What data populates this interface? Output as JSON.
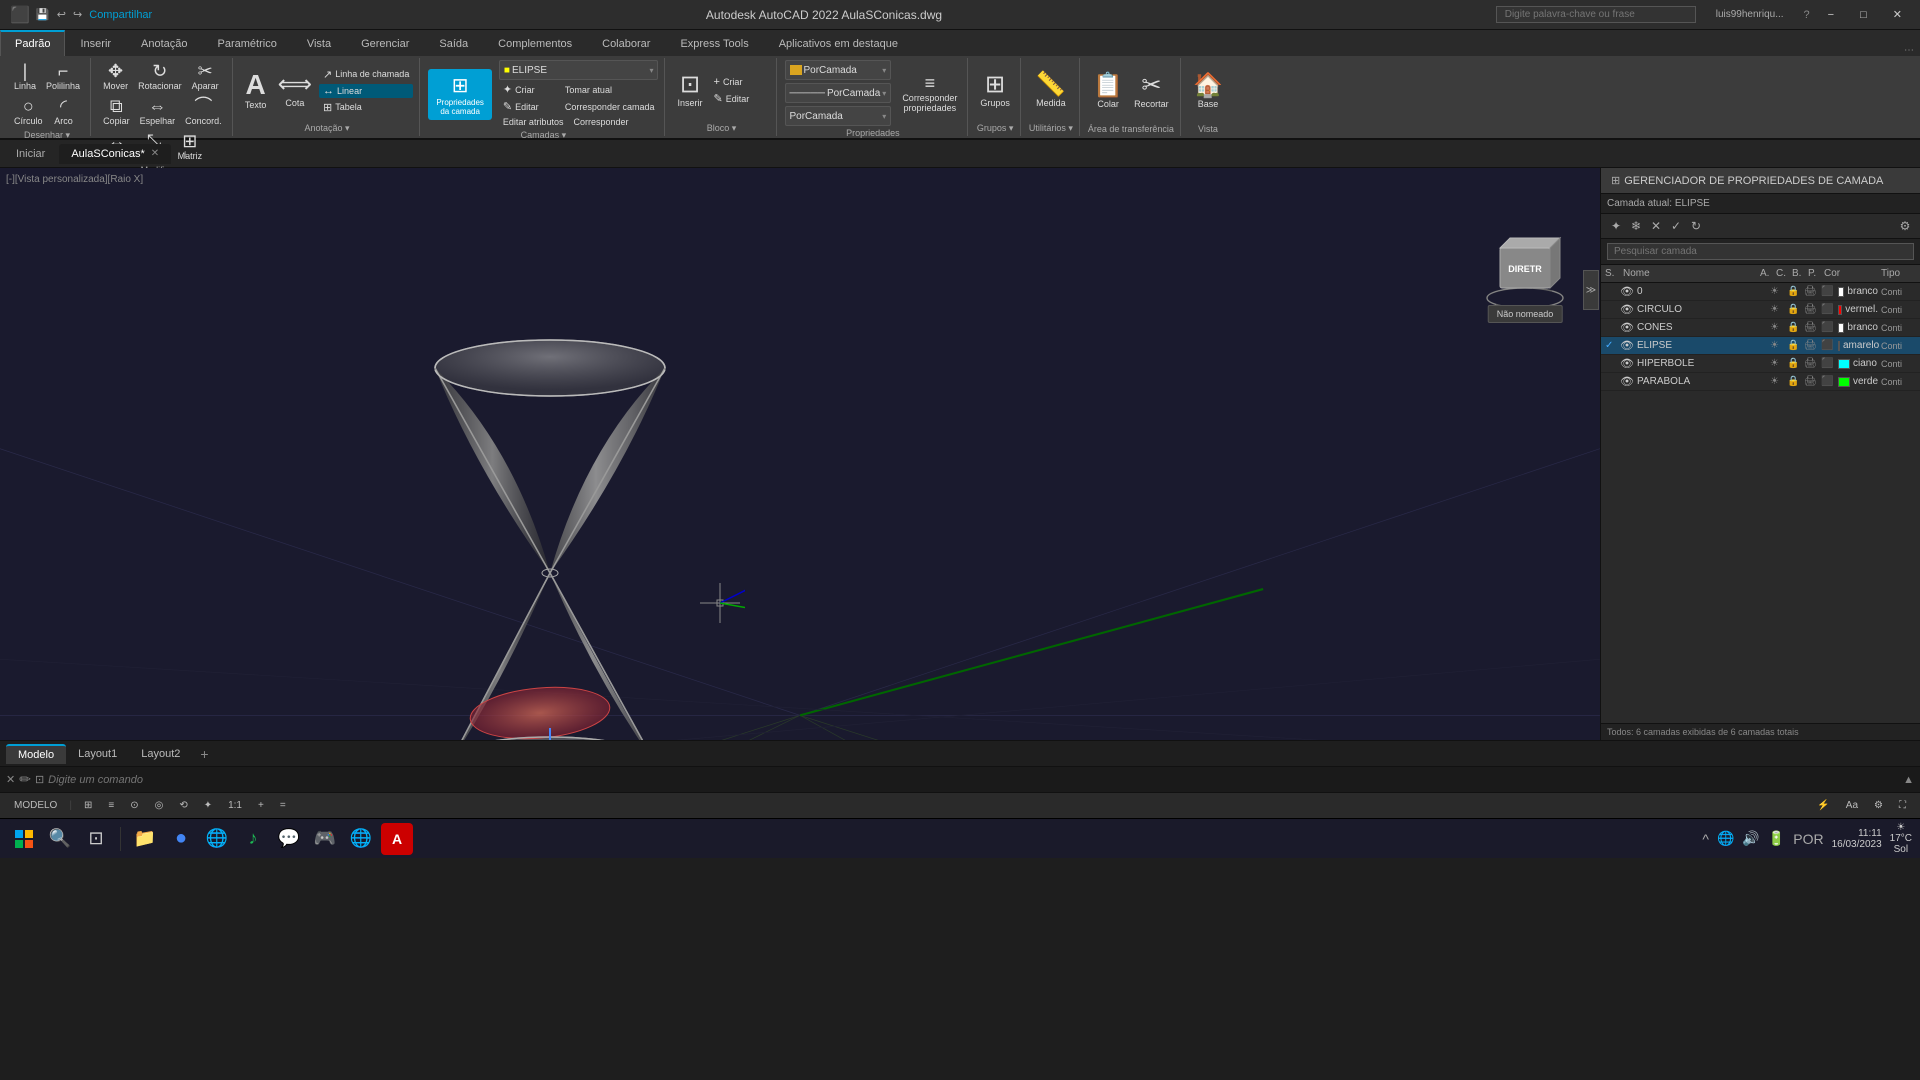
{
  "titlebar": {
    "title": "Autodesk AutoCAD 2022  AulaSConicas.dwg",
    "share_label": "Compartilhar",
    "search_placeholder": "Digite palavra-chave ou frase",
    "user": "luis99henriqu...",
    "min_label": "−",
    "max_label": "□",
    "close_label": "✕"
  },
  "ribbon": {
    "tabs": [
      "Padrão",
      "Inserir",
      "Anotação",
      "Paramétrico",
      "Vista",
      "Gerenciar",
      "Saída",
      "Complementos",
      "Colaborar",
      "Express Tools",
      "Aplicativos em destaque"
    ],
    "active_tab": "Padrão",
    "groups": {
      "desenhar": {
        "label": "Desenhar",
        "buttons": [
          "Linha",
          "Polilinha",
          "Círculo",
          "Arco"
        ]
      },
      "modificar": {
        "label": "Modificar",
        "buttons": [
          "Mover",
          "Rotacionar",
          "Aparar",
          "Copiar",
          "Espelhar",
          "Concord.",
          "Esticar",
          "Escala",
          "Matriz"
        ]
      },
      "anotacao": {
        "label": "Anotação",
        "buttons": [
          "Texto",
          "Cota",
          "Linha de chamada",
          "Tabela",
          "Linear"
        ]
      },
      "camadas": {
        "label": "Camadas",
        "buttons": [
          "ELIPSE",
          "Criar",
          "Editar",
          "Propriedades da camada",
          "Corresponder",
          "Corresponder camada",
          "Editar atributos"
        ]
      },
      "bloco": {
        "label": "Bloco",
        "buttons": [
          "Inserir",
          "Criar",
          "Editar"
        ]
      },
      "propriedades": {
        "label": "Propriedades",
        "dropdowns": [
          "PorCamada",
          "PorCamada",
          "PorCamada"
        ]
      },
      "grupos": {
        "label": "Grupos"
      },
      "utilitarios": {
        "label": "Utilitários"
      },
      "area_transferencia": {
        "label": "Área de transferência"
      },
      "vista": {
        "label": "Vista"
      }
    }
  },
  "document_tabs": {
    "home": "Iniciar",
    "tabs": [
      {
        "label": "AulaSConicas*",
        "active": true
      }
    ],
    "new_tab": "+"
  },
  "viewport": {
    "label": "[-][Vista personalizada][Raio X]",
    "tooltip": "Não nomeado"
  },
  "layer_panel": {
    "title": "GERENCIADOR DE PROPRIEDADES DE CAMADA",
    "current_layer_label": "Camada atual: ELIPSE",
    "search_placeholder": "Pesquisar camada",
    "headers": [
      "S.",
      "Nome",
      "A.",
      "C.",
      "B.",
      "P.",
      "Cor",
      "Tipo"
    ],
    "layers": [
      {
        "name": "0",
        "visible": true,
        "frozen": false,
        "locked": false,
        "color": "branco",
        "color_hex": "#ffffff",
        "type": "Conti"
      },
      {
        "name": "CIRCULO",
        "visible": true,
        "frozen": false,
        "locked": false,
        "color": "vermel.",
        "color_hex": "#ff0000",
        "type": "Conti"
      },
      {
        "name": "CONES",
        "visible": true,
        "frozen": false,
        "locked": false,
        "color": "branco",
        "color_hex": "#ffffff",
        "type": "Conti"
      },
      {
        "name": "ELIPSE",
        "visible": true,
        "frozen": false,
        "locked": false,
        "color": "amarelo",
        "color_hex": "#ffff00",
        "type": "Conti",
        "active": true
      },
      {
        "name": "HIPERBOLE",
        "visible": true,
        "frozen": false,
        "locked": false,
        "color": "ciano",
        "color_hex": "#00ffff",
        "type": "Conti"
      },
      {
        "name": "PARABOLA",
        "visible": true,
        "frozen": false,
        "locked": false,
        "color": "verde",
        "color_hex": "#00ff00",
        "type": "Conti"
      }
    ],
    "status": "Todos: 6 camadas exibidas de 6 camadas totais"
  },
  "model_tabs": {
    "tabs": [
      "Modelo",
      "Layout1",
      "Layout2"
    ],
    "active": "Modelo",
    "new": "+"
  },
  "statusbar": {
    "model_label": "MODELO",
    "buttons": [
      "⊞",
      "≡",
      "⊙",
      "◎",
      "⟲",
      "✦",
      "1:1",
      "+",
      "=",
      "🖥"
    ]
  },
  "cmdline": {
    "placeholder": "Digite um comando"
  },
  "taskbar": {
    "weather": {
      "temp": "17°C",
      "condition": "Sol"
    },
    "time": "11:11",
    "date": "16/03/2023",
    "language": "POR"
  }
}
